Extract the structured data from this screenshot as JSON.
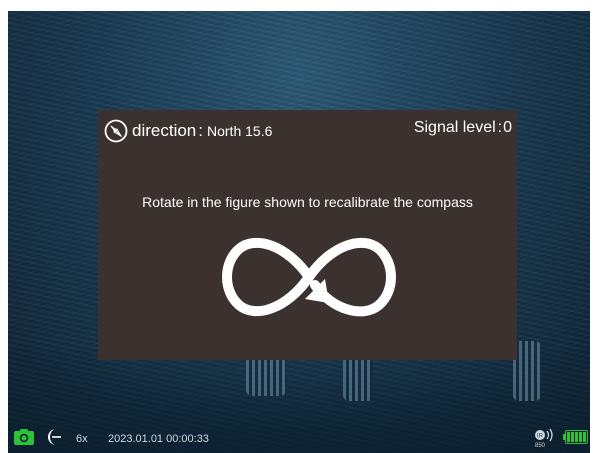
{
  "dialog": {
    "direction_label": "direction",
    "direction_sep": ":",
    "direction_value": "North 15.6",
    "signal_label": "Signal level",
    "signal_sep": ":",
    "signal_value": "0",
    "instruction": "Rotate in the figure shown to recalibrate the compass",
    "icons": {
      "compass": "compass-icon",
      "figure_eight": "figure-eight-rotation-icon"
    }
  },
  "status_bar": {
    "zoom": "6x",
    "datetime": "2023.01.01 00:00:33",
    "ir_label": "IR",
    "ir_wavelength": "850",
    "icons": {
      "camera": "camera-icon",
      "night_mode": "moon-icon",
      "ir": "ir-illuminator-icon",
      "battery": "battery-icon"
    },
    "battery_level": 1.0
  },
  "colors": {
    "dialog_bg": "#3b322f",
    "accent_green": "#2ec23a",
    "text_white": "#ffffff"
  }
}
